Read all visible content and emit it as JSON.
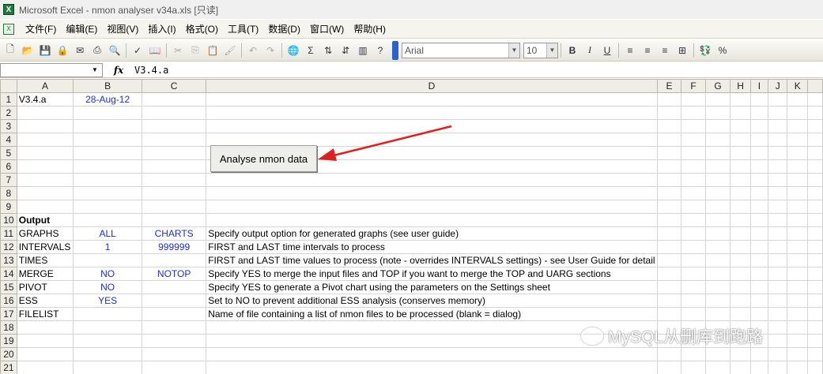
{
  "window": {
    "title": "Microsoft Excel - nmon analyser v34a.xls  [只读]",
    "app_icon": "X"
  },
  "menu": [
    "文件(F)",
    "编辑(E)",
    "视图(V)",
    "插入(I)",
    "格式(O)",
    "工具(T)",
    "数据(D)",
    "窗口(W)",
    "帮助(H)"
  ],
  "toolbar": {
    "font": "Arial",
    "size": "10",
    "bold": "B",
    "italic": "I",
    "underline": "U",
    "percent": "%",
    "sigma": "Σ"
  },
  "formula_bar": {
    "name_box": "",
    "fx": "fx",
    "value": "V3.4.a"
  },
  "columns": [
    "A",
    "B",
    "C",
    "D",
    "E",
    "F",
    "G",
    "H",
    "I",
    "J",
    "K"
  ],
  "rows": [
    {
      "n": "1",
      "A": "V3.4.a",
      "B": "28-Aug-12",
      "C": "",
      "D": ""
    },
    {
      "n": "2",
      "A": "",
      "B": "",
      "C": "",
      "D": ""
    },
    {
      "n": "3",
      "A": "",
      "B": "",
      "C": "",
      "D": ""
    },
    {
      "n": "4",
      "A": "",
      "B": "",
      "C": "",
      "D": ""
    },
    {
      "n": "5",
      "A": "",
      "B": "",
      "C": "",
      "D": ""
    },
    {
      "n": "6",
      "A": "",
      "B": "",
      "C": "",
      "D": ""
    },
    {
      "n": "7",
      "A": "",
      "B": "",
      "C": "",
      "D": ""
    },
    {
      "n": "8",
      "A": "",
      "B": "",
      "C": "",
      "D": ""
    },
    {
      "n": "9",
      "A": "",
      "B": "",
      "C": "",
      "D": ""
    },
    {
      "n": "10",
      "A": "Output",
      "B": "",
      "C": "",
      "D": ""
    },
    {
      "n": "11",
      "A": "GRAPHS",
      "B": "ALL",
      "C": "CHARTS",
      "D": "Specify output option for generated graphs (see user guide)"
    },
    {
      "n": "12",
      "A": "INTERVALS",
      "B": "1",
      "C": "999999",
      "D": "FIRST and LAST time intervals to process"
    },
    {
      "n": "13",
      "A": "TIMES",
      "B": "",
      "C": "",
      "D": "FIRST and LAST time values to process (note - overrides INTERVALS settings) - see User Guide for detail"
    },
    {
      "n": "14",
      "A": "MERGE",
      "B": "NO",
      "C": "NOTOP",
      "D": "Specify YES to merge the input files and TOP if you want to merge the TOP and UARG sections"
    },
    {
      "n": "15",
      "A": "PIVOT",
      "B": "NO",
      "C": "",
      "D": "Specify YES to generate a Pivot chart using the parameters on the Settings sheet"
    },
    {
      "n": "16",
      "A": "ESS",
      "B": "YES",
      "C": "",
      "D": "Set to NO to prevent additional ESS analysis (conserves memory)"
    },
    {
      "n": "17",
      "A": "FILELIST",
      "B": "",
      "C": "",
      "D": "Name of file containing a list of nmon files to be processed (blank = dialog)"
    },
    {
      "n": "18",
      "A": "",
      "B": "",
      "C": "",
      "D": ""
    },
    {
      "n": "19",
      "A": "",
      "B": "",
      "C": "",
      "D": ""
    },
    {
      "n": "20",
      "A": "",
      "B": "",
      "C": "",
      "D": ""
    },
    {
      "n": "21",
      "A": "",
      "B": "",
      "C": "",
      "D": ""
    }
  ],
  "macro_button": {
    "label": "Analyse nmon data"
  },
  "annotation_arrow_color": "#e02020",
  "watermark": {
    "text": "MySQL从删库到跑路"
  }
}
